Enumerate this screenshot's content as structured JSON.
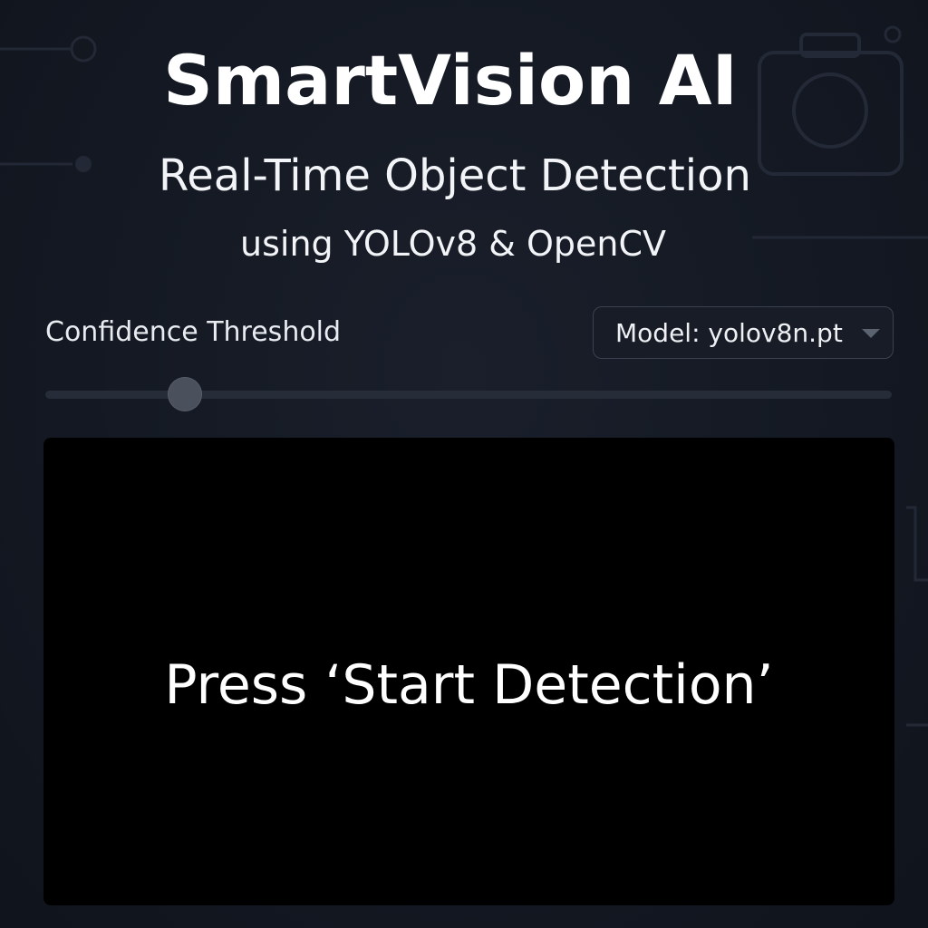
{
  "header": {
    "title": "SmartVision AI",
    "subtitle": "Real-Time Object Detection",
    "subtitle2": "using YOLOv8 & OpenCV"
  },
  "controls": {
    "confidence_label": "Confidence Threshold",
    "confidence_value": 0.165,
    "model_select_value": "Model: yolov8n.pt"
  },
  "viewer": {
    "message": "Press ‘Start Detection’"
  },
  "colors": {
    "background": "#141923",
    "panel": "#000000",
    "text": "#ffffff",
    "slider_thumb": "#4a505c"
  },
  "icons": {
    "background_decoration": "camera-icon",
    "select_arrow": "chevron-down-icon"
  }
}
